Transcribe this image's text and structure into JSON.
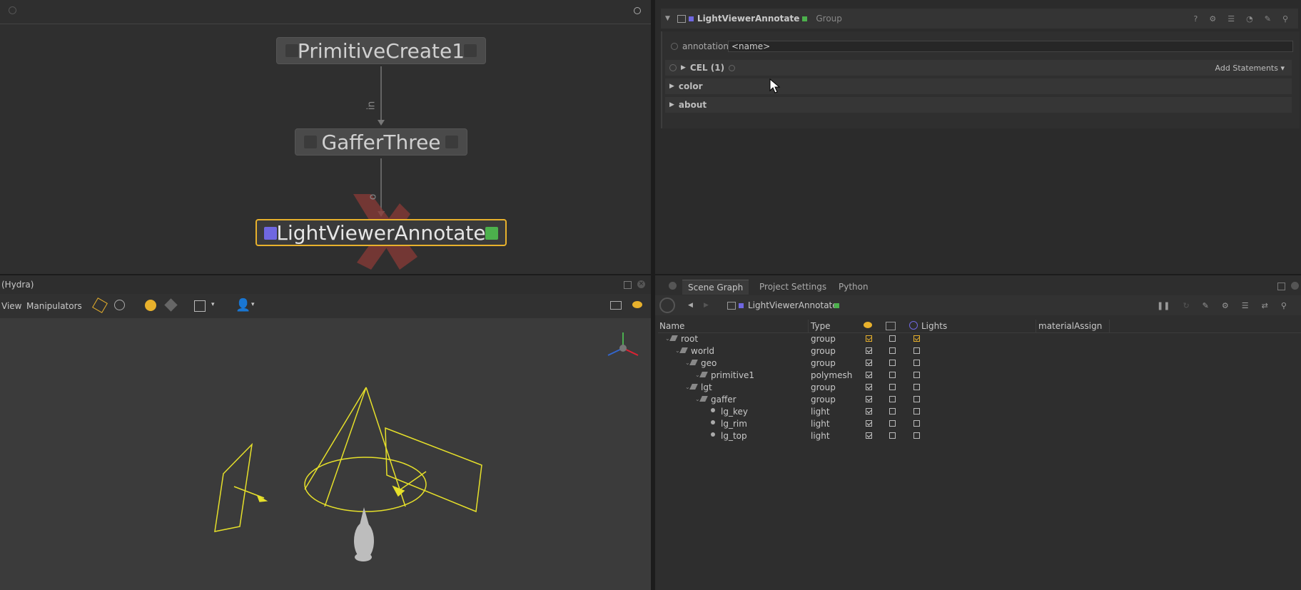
{
  "colors": {
    "accent": "#e8b12c",
    "node_purple": "#6f67e0",
    "node_green": "#4cb04c"
  },
  "nodegraph": {
    "nodes": [
      "PrimitiveCreate1",
      "GafferThree",
      "LightViewerAnnotate"
    ],
    "port_in": "in",
    "port_out": "o"
  },
  "params": {
    "node_name": "LightViewerAnnotate",
    "node_type": "Group",
    "annotation_label": "annotation",
    "annotation_value": "<name>",
    "cel_label": "CEL (1)",
    "add_statements": "Add Statements",
    "sections": [
      "color",
      "about"
    ]
  },
  "viewer": {
    "tab_title": "(Hydra)",
    "menus": [
      "View",
      "Manipulators"
    ]
  },
  "scenegraph": {
    "tabs": [
      "Scene Graph",
      "Project Settings",
      "Python"
    ],
    "breadcrumb": "LightViewerAnnotate",
    "columns": {
      "name": "Name",
      "type": "Type",
      "lights": "Lights",
      "material": "materialAssign"
    },
    "rows": [
      {
        "name": "root",
        "type": "group",
        "vis": true,
        "c2": false,
        "c3": true
      },
      {
        "name": "world",
        "type": "group",
        "vis": true,
        "c2": false,
        "c3": false
      },
      {
        "name": "geo",
        "type": "group",
        "vis": true,
        "c2": false,
        "c3": false
      },
      {
        "name": "primitive1",
        "type": "polymesh",
        "vis": true,
        "c2": false,
        "c3": false
      },
      {
        "name": "lgt",
        "type": "group",
        "vis": true,
        "c2": false,
        "c3": false
      },
      {
        "name": "gaffer",
        "type": "group",
        "vis": true,
        "c2": false,
        "c3": false
      },
      {
        "name": "lg_key",
        "type": "light",
        "vis": true,
        "c2": false,
        "c3": false
      },
      {
        "name": "lg_rim",
        "type": "light",
        "vis": true,
        "c2": false,
        "c3": false
      },
      {
        "name": "lg_top",
        "type": "light",
        "vis": true,
        "c2": false,
        "c3": false
      }
    ]
  }
}
